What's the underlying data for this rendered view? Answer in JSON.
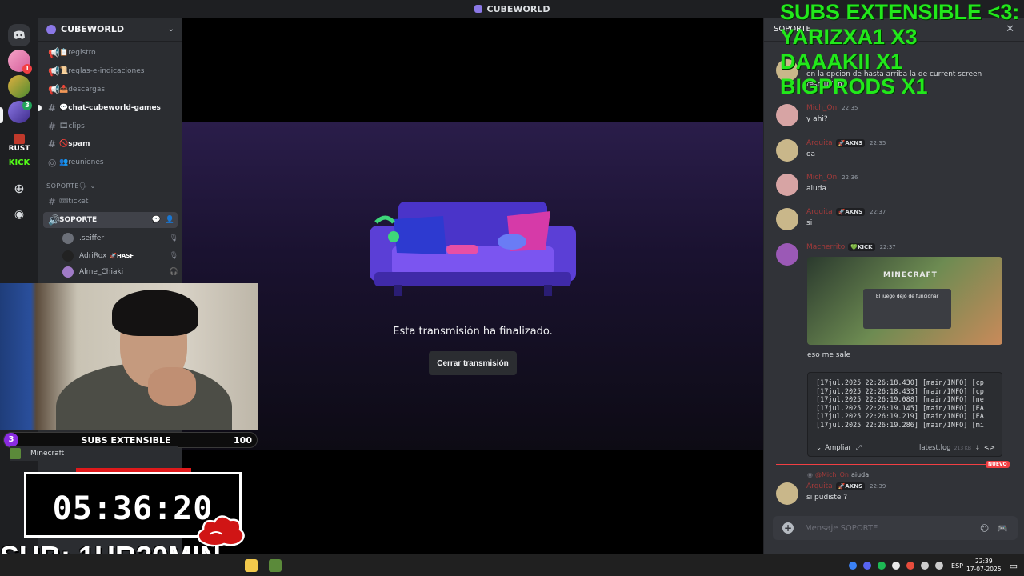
{
  "window": {
    "title": "CUBEWORLD"
  },
  "server": {
    "name": "CUBEWORLD"
  },
  "rail": {
    "badge_pink": "1",
    "badge_cw": "3",
    "rust_label": "RUST",
    "kick_label": "KICK"
  },
  "channels": [
    {
      "name": "𝔘registro",
      "label": "📋registro"
    },
    {
      "label": "📜reglas-e-indicaciones"
    },
    {
      "label": "📥descargas"
    },
    {
      "label": "💬chat-cubeworld-games"
    },
    {
      "label": "🎞clips"
    },
    {
      "label": "🚫spam"
    },
    {
      "label": "👥reuniones"
    }
  ],
  "category": {
    "label": "SOPORTE🗣 ⌄"
  },
  "ticket_channel": {
    "label": "🎟ticket"
  },
  "voice_channel": {
    "label": "SOPORTE"
  },
  "voice_users": [
    {
      "name": ".seiffer",
      "tag": ""
    },
    {
      "name": "AdriRox",
      "tag": "🚀HASF"
    },
    {
      "name": "Alme_Chiaki",
      "tag": ""
    }
  ],
  "stream": {
    "ended_text": "Esta transmisión ha finalizado.",
    "close_button": "Cerrar transmisión"
  },
  "chat": {
    "header": "SOPORTE",
    "first_line": "en la opcion de hasta arriba la de current screen",
    "first_line_cont": "resolution",
    "messages": [
      {
        "name": "Mich_On",
        "role": "",
        "time": "22:35",
        "text": "y ahi?",
        "av": "#d7a4a4"
      },
      {
        "name": "Arquita",
        "role": "🚀AKNS",
        "time": "22:35",
        "text": "oa",
        "av": "#c9b78a"
      },
      {
        "name": "Mich_On",
        "role": "",
        "time": "22:36",
        "text": "aiuda",
        "av": "#d7a4a4"
      },
      {
        "name": "Arquita",
        "role": "🚀AKNS",
        "time": "22:37",
        "text": "si",
        "av": "#c9b78a"
      },
      {
        "name": "Macherrito",
        "role": "💚KICK",
        "time": "22:37",
        "text": "",
        "av": "#9b59b6"
      }
    ],
    "embed_title": "MINECRAFT",
    "embed_dialog": "El juego dejó de funcionar",
    "eso_me_sale": "eso me sale",
    "log_lines": [
      "[17jul.2025 22:26:18.430] [main/INFO] [cp",
      "[17jul.2025 22:26:18.433] [main/INFO] [cp",
      "[17jul.2025 22:26:19.088] [main/INFO] [ne",
      "[17jul.2025 22:26:19.145] [main/INFO] [EA",
      "[17jul.2025 22:26:19.219] [main/INFO] [EA",
      "[17jul.2025 22:26:19.286] [main/INFO] [mi"
    ],
    "expand_label": "Ampliar",
    "log_file": "latest.log",
    "log_size": "213 KB",
    "new_label": "NUEVO",
    "reply_to": "@Mich_On",
    "reply_text": "aiuda",
    "last": {
      "name": "Arquita",
      "role": "🚀AKNS",
      "time": "22:39",
      "text": "si pudiste ?"
    },
    "composer_placeholder": "Mensaje SOPORTE"
  },
  "overlay": {
    "subs_count": "3",
    "subs_label": "SUBS EXTENSIBLE",
    "subs_goal": "100",
    "minecraft_label": "Minecraft",
    "timer": "05:36:20",
    "sub_time": "SUB: 1HR20MIN",
    "subs_list": [
      "SUBS EXTENSIBLE <3:",
      "YARIZXA1 X3",
      "DAAAKII X1",
      "BIGPRODS X1"
    ]
  },
  "taskbar": {
    "lang": "ESP",
    "time": "22:39",
    "date": "17-07-2025"
  }
}
